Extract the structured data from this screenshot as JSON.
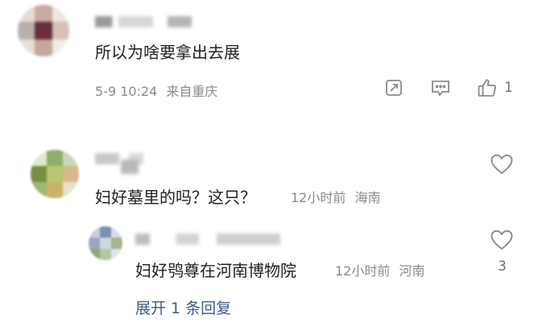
{
  "comments": [
    {
      "text": "所以为啥要拿出去展",
      "time": "5-9 10:24",
      "location": "来自重庆",
      "like_count": "1"
    },
    {
      "text": "妇好墓里的吗？这只？",
      "time": "12小时前",
      "location": "海南",
      "replies": [
        {
          "text": "妇好鸮尊在河南博物院",
          "time": "12小时前",
          "location": "河南",
          "like_count": "3"
        }
      ],
      "expand_label": "展开 1 条回复"
    }
  ],
  "colors": {
    "text": "#1f1f1f",
    "meta": "#8a8a8a",
    "link": "#3d5a8a"
  },
  "icons": [
    "share-icon",
    "comment-icon",
    "thumbs-up-icon",
    "heart-icon"
  ]
}
